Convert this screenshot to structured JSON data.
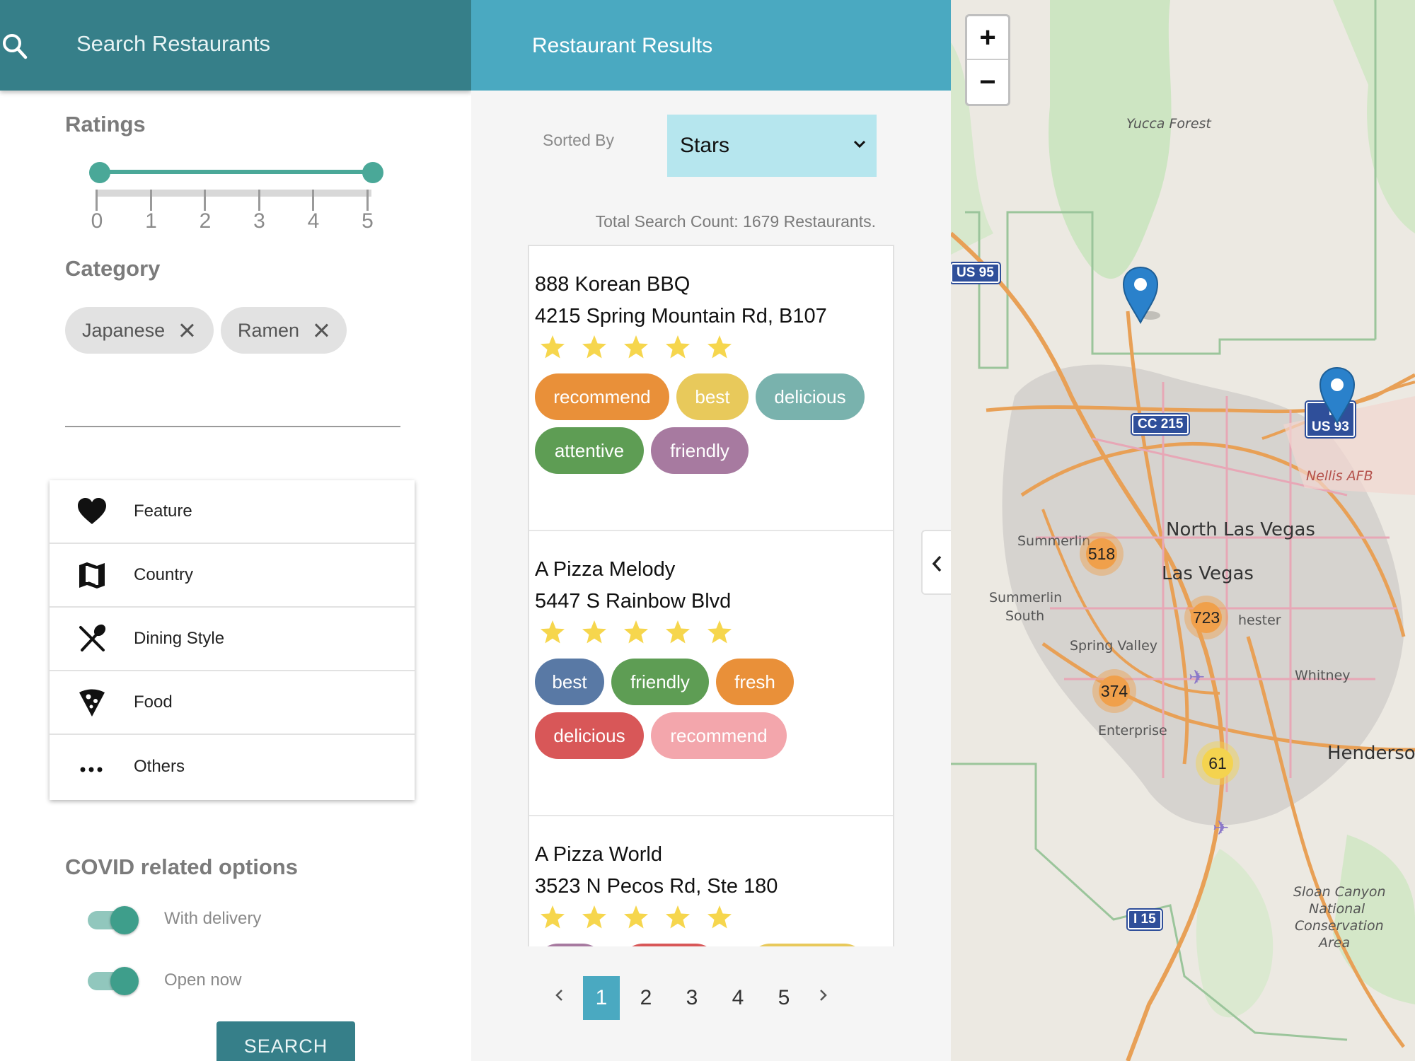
{
  "search_panel": {
    "title": "Search Restaurants",
    "ratings_label": "Ratings",
    "rating_ticks": [
      "0",
      "1",
      "2",
      "3",
      "4",
      "5"
    ],
    "rating_range": [
      0,
      5
    ],
    "category_label": "Category",
    "chips": [
      {
        "label": "Japanese"
      },
      {
        "label": "Ramen"
      }
    ],
    "category_input_value": "",
    "filters": [
      {
        "label": "Feature",
        "icon": "heart-icon"
      },
      {
        "label": "Country",
        "icon": "map-icon"
      },
      {
        "label": "Dining Style",
        "icon": "utensils-icon"
      },
      {
        "label": "Food",
        "icon": "pizza-icon"
      },
      {
        "label": "Others",
        "icon": "more-icon"
      }
    ],
    "covid_label": "COVID related options",
    "toggles": [
      {
        "label": "With delivery",
        "on": true
      },
      {
        "label": "Open now",
        "on": true
      }
    ],
    "search_button": "SEARCH",
    "accent": "#367f89"
  },
  "results_panel": {
    "title": "Restaurant Results",
    "sorted_by_label": "Sorted By",
    "sort_value": "Stars",
    "total_count": "Total Search Count: 1679 Restaurants.",
    "restaurants": [
      {
        "name": "888 Korean BBQ",
        "address": "4215 Spring Mountain Rd, B107",
        "stars": 5,
        "tags": [
          {
            "label": "recommend",
            "color": "#e99039"
          },
          {
            "label": "best",
            "color": "#e8c95b"
          },
          {
            "label": "delicious",
            "color": "#79b2ad"
          },
          {
            "label": "attentive",
            "color": "#5e9d54"
          },
          {
            "label": "friendly",
            "color": "#a77aa0"
          }
        ]
      },
      {
        "name": "A Pizza Melody",
        "address": "5447 S Rainbow Blvd",
        "stars": 5,
        "tags": [
          {
            "label": "best",
            "color": "#5979a5"
          },
          {
            "label": "friendly",
            "color": "#5e9d54"
          },
          {
            "label": "fresh",
            "color": "#e99039"
          },
          {
            "label": "delicious",
            "color": "#d85758"
          },
          {
            "label": "recommend",
            "color": "#f3a6ac"
          }
        ]
      },
      {
        "name": "A Pizza World",
        "address": "3523 N Pecos Rd, Ste 180",
        "stars": 5,
        "tags": [
          {
            "label": "",
            "color": "#a77aa0"
          },
          {
            "label": "",
            "color": "#d85758"
          },
          {
            "label": "",
            "color": "#e8c95b"
          }
        ]
      }
    ],
    "pagination": {
      "pages": [
        "1",
        "2",
        "3",
        "4",
        "5"
      ],
      "current": "1"
    },
    "star_color": "#f6d64d"
  },
  "map": {
    "zoom_in": "+",
    "zoom_out": "−",
    "clusters": [
      {
        "count": "518",
        "color": "#f0a04b"
      },
      {
        "count": "723",
        "color": "#f0a04b"
      },
      {
        "count": "374",
        "color": "#f0a04b"
      },
      {
        "count": "61",
        "color": "#f4d34f"
      }
    ],
    "labels": {
      "yucca_forest": "Yucca Forest",
      "north_las_vegas": "North Las Vegas",
      "las_vegas": "Las Vegas",
      "summerlin": "Summerlin",
      "summerlin_south_1": "Summerlin",
      "summerlin_south_2": "South",
      "spring_valley": "Spring Valley",
      "enterprise": "Enterprise",
      "whitney": "Whitney",
      "henderson": "Henderson",
      "nellis_afb": "Nellis AFB",
      "sunrise_manor": "hester",
      "sloan_1": "Sloan Canyon",
      "sloan_2": "National",
      "sloan_3": "Conservation",
      "sloan_4": "Area"
    },
    "shields": {
      "us95": "US 95",
      "cc215": "CC 215",
      "us93_1": "I",
      "us93_2": "US 93",
      "i15": "I 15"
    },
    "marker_color": "#2a81cb"
  }
}
